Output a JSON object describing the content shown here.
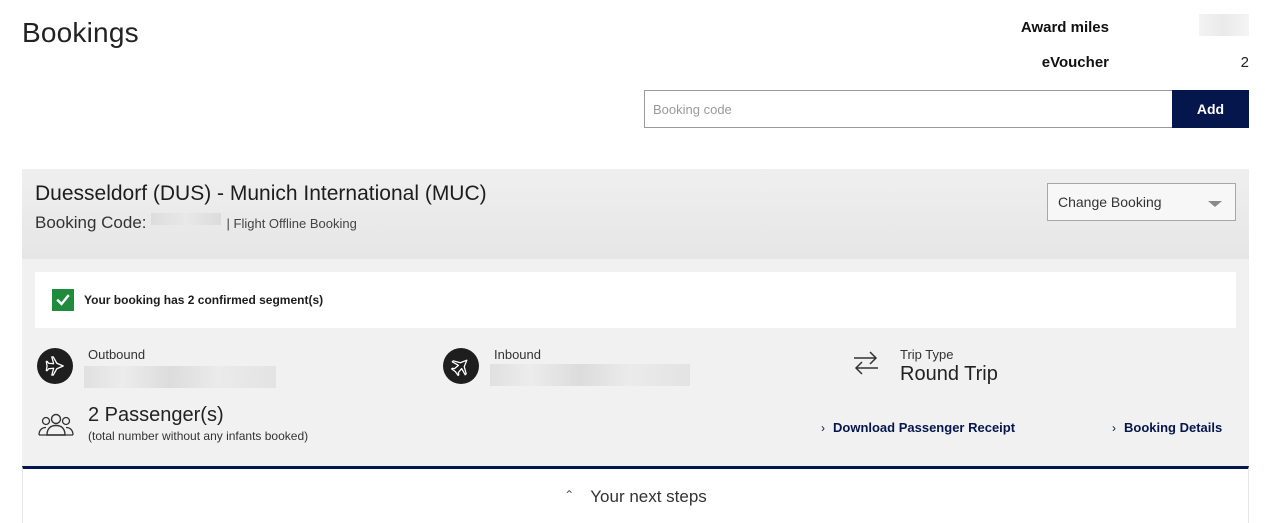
{
  "page": {
    "title": "Bookings"
  },
  "stats": {
    "award_miles_label": "Award miles",
    "award_miles_value": "",
    "evoucher_label": "eVoucher",
    "evoucher_value": "2"
  },
  "add_booking": {
    "placeholder": "Booking code",
    "button_label": "Add"
  },
  "booking": {
    "route": "Duesseldorf (DUS) - Munich International (MUC)",
    "code_label": "Booking Code:",
    "code_value": "",
    "type_label": "| Flight Offline Booking",
    "change_select": "Change Booking",
    "confirmation": "Your booking has 2 confirmed segment(s)",
    "outbound_label": "Outbound",
    "inbound_label": "Inbound",
    "trip_type_label": "Trip Type",
    "trip_type_value": "Round Trip",
    "passengers": "2 Passenger(s)",
    "passengers_note": "(total number without any infants booked)",
    "download_receipt": "Download Passenger Receipt",
    "booking_details": "Booking Details",
    "next_steps": "Your next steps"
  },
  "icons": {
    "check": "checkmark-icon",
    "outbound": "plane-departure-icon",
    "inbound": "plane-arrival-icon",
    "trip": "swap-arrows-icon",
    "passengers": "group-icon",
    "chevron": "chevron-right-icon",
    "caret": "caret-down-icon",
    "up": "chevron-up-icon"
  },
  "colors": {
    "brand_navy": "#05164d",
    "confirm_green": "#1f8b3c",
    "card_bg": "#f1f1f1"
  }
}
